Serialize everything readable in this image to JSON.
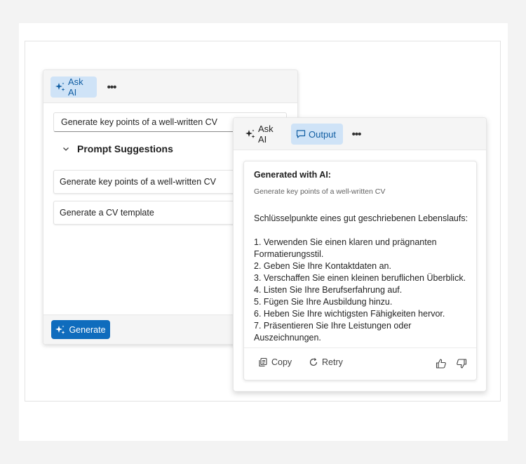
{
  "panel1": {
    "toolbar": {
      "ask_ai_label": "Ask AI",
      "more_label": "•••"
    },
    "prompt_input": {
      "value": "Generate key points of a well-written CV"
    },
    "suggestions": {
      "header": "Prompt Suggestions",
      "items": [
        {
          "label": "Generate key points of a well-written CV"
        },
        {
          "label": "Generate a CV template"
        }
      ]
    },
    "footer": {
      "generate_label": "Generate"
    }
  },
  "panel2": {
    "toolbar": {
      "ask_ai_label": "Ask AI",
      "output_label": "Output",
      "more_label": "•••"
    },
    "card": {
      "title": "Generated with AI:",
      "prompt": "Generate key points of a well-written CV",
      "intro": "Schlüsselpunkte eines gut geschriebenen Lebenslaufs:",
      "points": [
        "1. Verwenden Sie einen klaren und prägnanten Formatierungsstil.",
        "2. Geben Sie Ihre Kontaktdaten an.",
        "3. Verschaffen Sie einen kleinen beruflichen Überblick.",
        "4. Listen Sie Ihre Berufserfahrung auf.",
        "5. Fügen Sie Ihre Ausbildung hinzu.",
        "6. Heben Sie Ihre wichtigsten Fähigkeiten hervor.",
        "7. Präsentieren Sie Ihre Leistungen oder Auszeichnungen."
      ],
      "copy_label": "Copy",
      "retry_label": "Retry"
    }
  },
  "colors": {
    "accent": "#0f6cbd",
    "active_tab_bg": "#cfe3f7",
    "active_tab_text": "#115ea3"
  }
}
